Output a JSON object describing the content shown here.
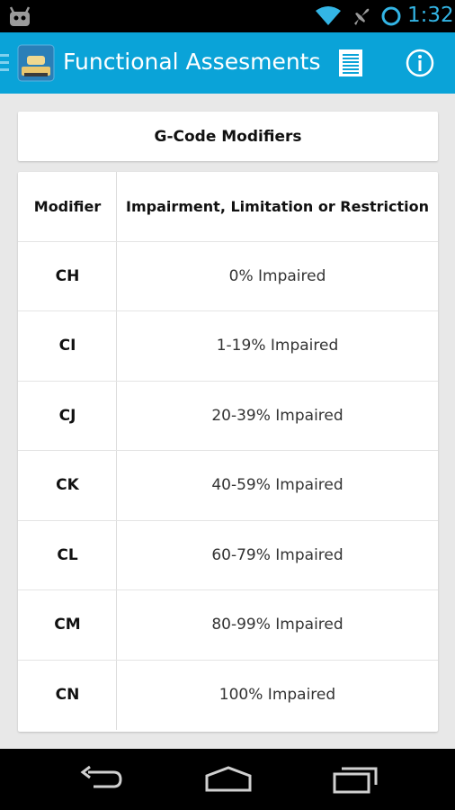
{
  "status_bar": {
    "time": "1:32",
    "icons": [
      "android-notification-icon",
      "wifi-icon",
      "airplane-mode-icon",
      "alarm-icon"
    ]
  },
  "action_bar": {
    "title": "Functional Assesments",
    "icons": [
      "drawer-indicator-icon",
      "app-icon",
      "list-icon",
      "info-icon"
    ]
  },
  "card": {
    "title": "G-Code Modifiers"
  },
  "table": {
    "headers": {
      "modifier": "Modifier",
      "impairment": "Impairment, Limitation or Restriction"
    },
    "rows": [
      {
        "modifier": "CH",
        "impairment": "0% Impaired"
      },
      {
        "modifier": "CI",
        "impairment": "1-19% Impaired"
      },
      {
        "modifier": "CJ",
        "impairment": "20-39% Impaired"
      },
      {
        "modifier": "CK",
        "impairment": "40-59% Impaired"
      },
      {
        "modifier": "CL",
        "impairment": "60-79% Impaired"
      },
      {
        "modifier": "CM",
        "impairment": "80-99% Impaired"
      },
      {
        "modifier": "CN",
        "impairment": "100% Impaired"
      }
    ]
  },
  "nav_bar": {
    "icons": [
      "back-icon",
      "home-icon",
      "recents-icon"
    ]
  },
  "colors": {
    "action_bar": "#0aa3d8",
    "status_icons": "#33b5e5",
    "background": "#e8e8e8"
  }
}
